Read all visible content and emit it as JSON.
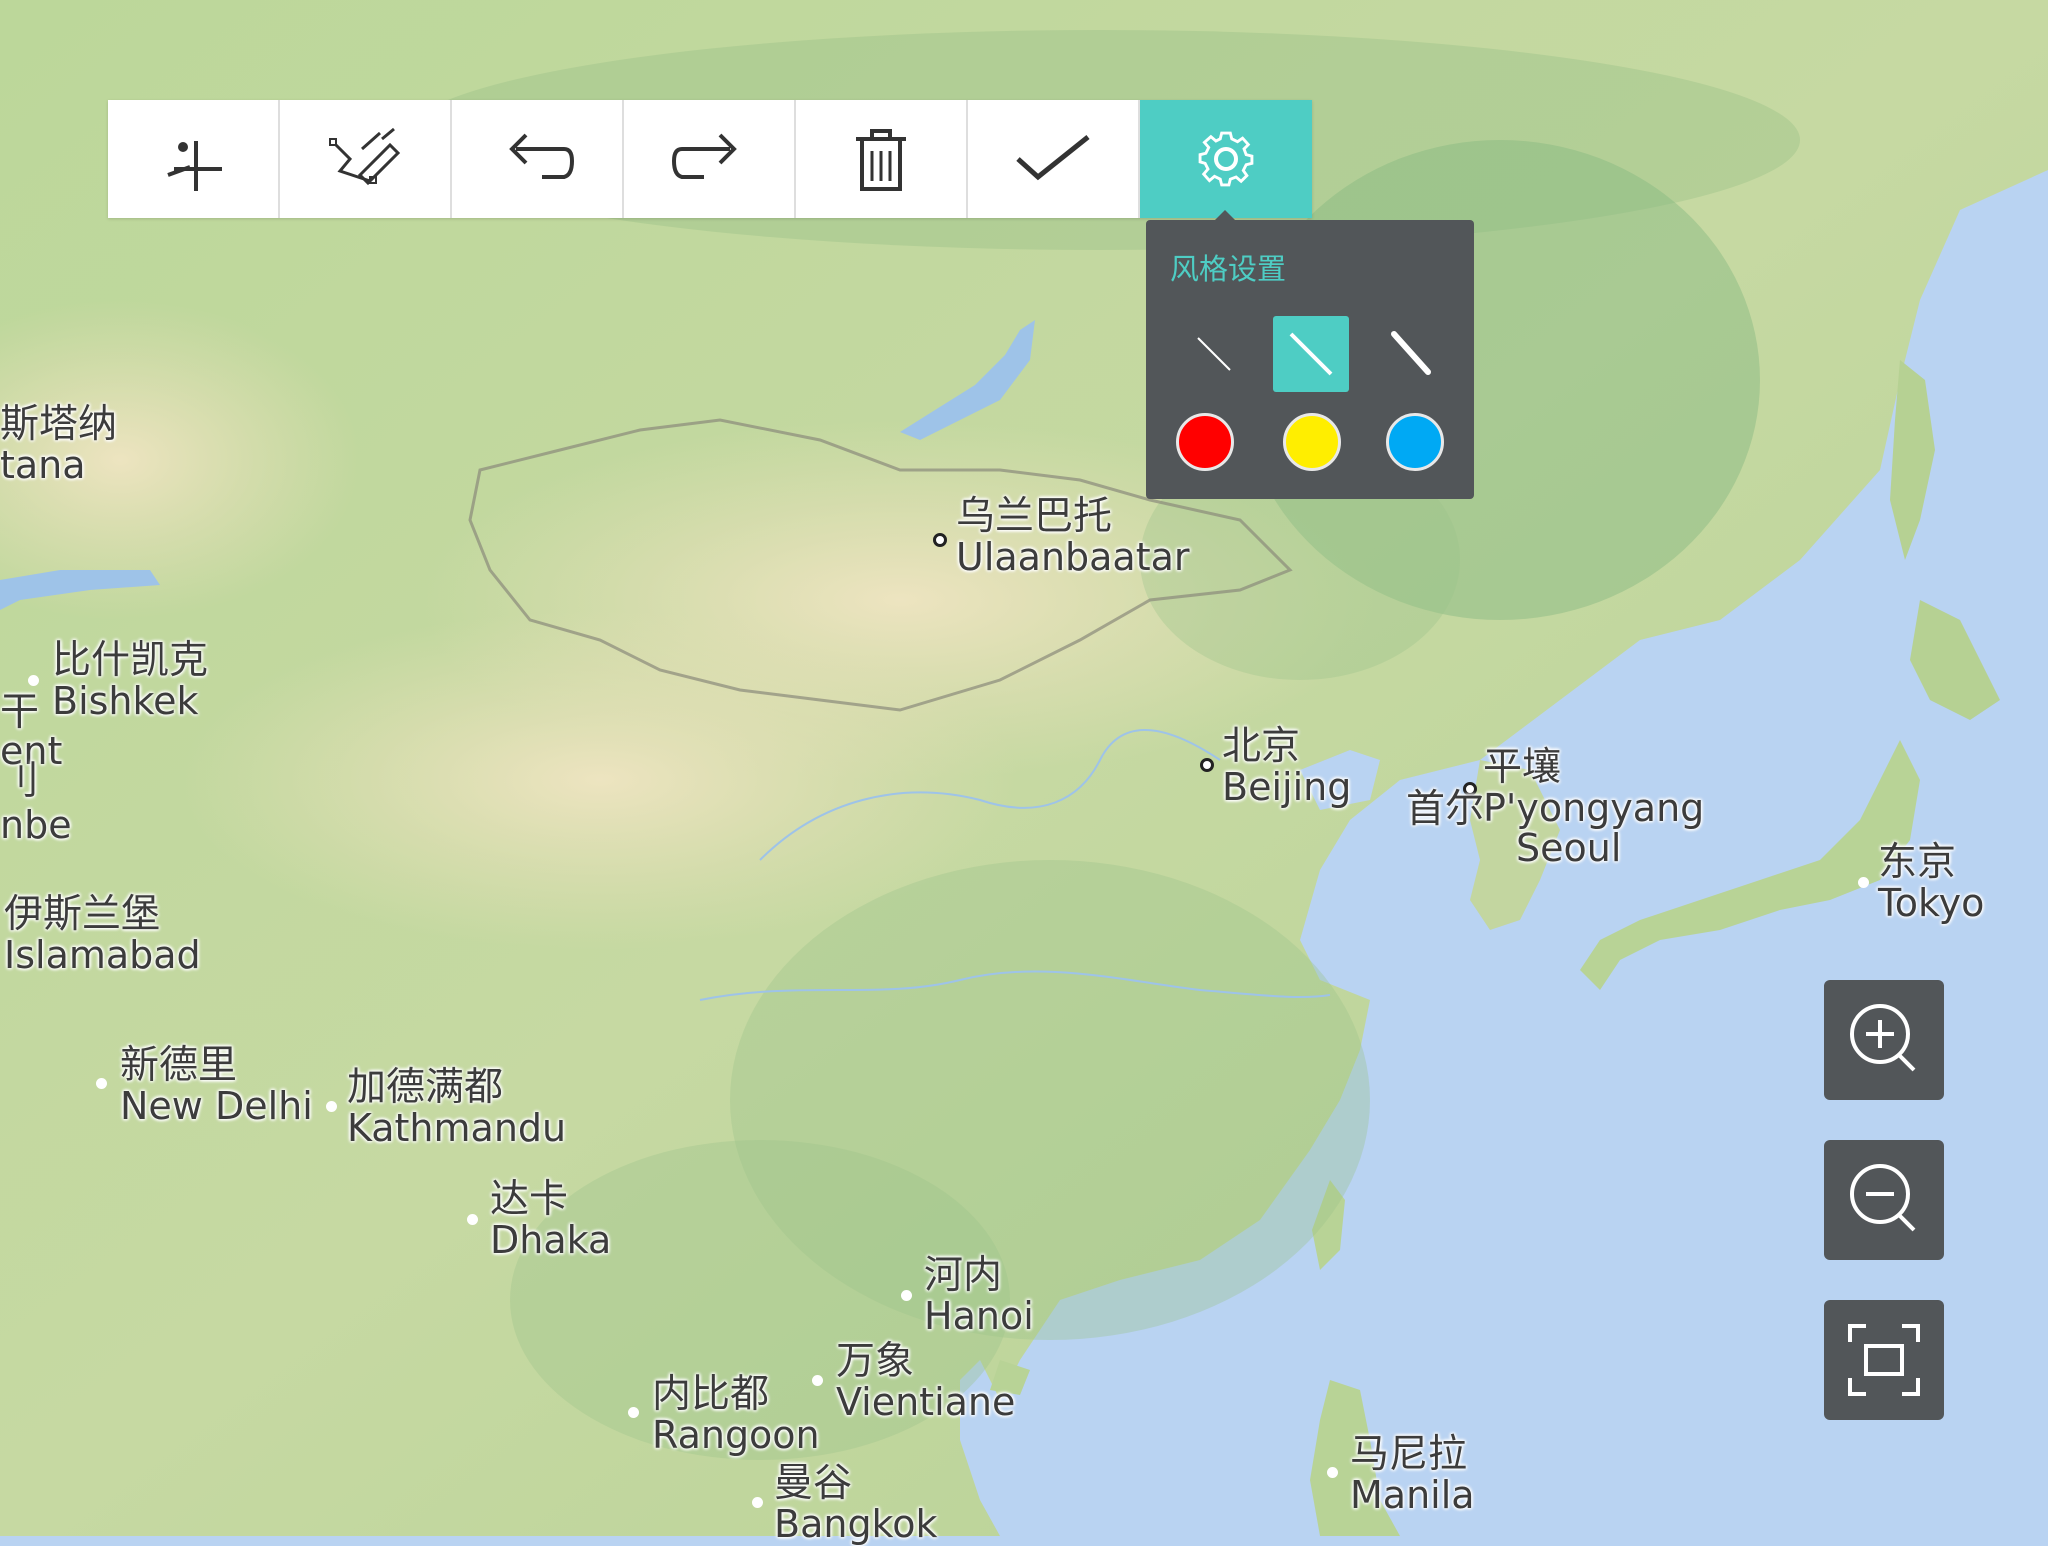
{
  "toolbar": {
    "buttons": [
      {
        "name": "add-point",
        "icon": "add-point-icon",
        "active": false
      },
      {
        "name": "draw-line",
        "icon": "pen-draw-icon",
        "active": false
      },
      {
        "name": "undo",
        "icon": "undo-icon",
        "active": false
      },
      {
        "name": "redo",
        "icon": "redo-icon",
        "active": false
      },
      {
        "name": "delete",
        "icon": "trash-icon",
        "active": false
      },
      {
        "name": "confirm",
        "icon": "checkmark-icon",
        "active": false
      },
      {
        "name": "settings",
        "icon": "gear-icon",
        "active": true
      }
    ]
  },
  "style_popup": {
    "title": "风格设置",
    "line_widths": [
      {
        "name": "thin",
        "selected": false
      },
      {
        "name": "medium",
        "selected": true
      },
      {
        "name": "thick",
        "selected": false
      }
    ],
    "colors": [
      {
        "name": "red",
        "hex": "#ff0000"
      },
      {
        "name": "yellow",
        "hex": "#ffee00"
      },
      {
        "name": "blue",
        "hex": "#00a9f4"
      }
    ]
  },
  "map_controls": [
    {
      "name": "zoom-in",
      "icon": "zoom-in-icon"
    },
    {
      "name": "zoom-out",
      "icon": "zoom-out-icon"
    },
    {
      "name": "fit-view",
      "icon": "fit-screen-icon"
    }
  ],
  "theme": {
    "accent": "#4ecdc4",
    "panel": "#525659",
    "ocean": "#b9d3f2",
    "land": "#c9d9a3"
  },
  "cities": [
    {
      "zh": "斯塔纳",
      "en": "tana"
    },
    {
      "zh": "乌兰巴托",
      "en": "Ulaanbaatar"
    },
    {
      "zh": "比什凯克",
      "en": "Bishkek"
    },
    {
      "zh": "干",
      "en": ""
    },
    {
      "zh": "",
      "en": "ent"
    },
    {
      "zh": "刂",
      "en": ""
    },
    {
      "zh": "",
      "en": "nbe"
    },
    {
      "zh": "伊斯兰堡",
      "en": "Islamabad"
    },
    {
      "zh": "北京",
      "en": "Beijing"
    },
    {
      "zh": "平壤",
      "en": "P'yongyang"
    },
    {
      "zh": "首尔",
      "en": "Seoul"
    },
    {
      "zh": "东京",
      "en": "Tokyo"
    },
    {
      "zh": "新德里",
      "en": "New Delhi"
    },
    {
      "zh": "加德满都",
      "en": "Kathmandu"
    },
    {
      "zh": "达卡",
      "en": "Dhaka"
    },
    {
      "zh": "河内",
      "en": "Hanoi"
    },
    {
      "zh": "万象",
      "en": "Vientiane"
    },
    {
      "zh": "内比都",
      "en": "Rangoon"
    },
    {
      "zh": "曼谷",
      "en": "Bangkok"
    },
    {
      "zh": "马尼拉",
      "en": "Manila"
    }
  ]
}
